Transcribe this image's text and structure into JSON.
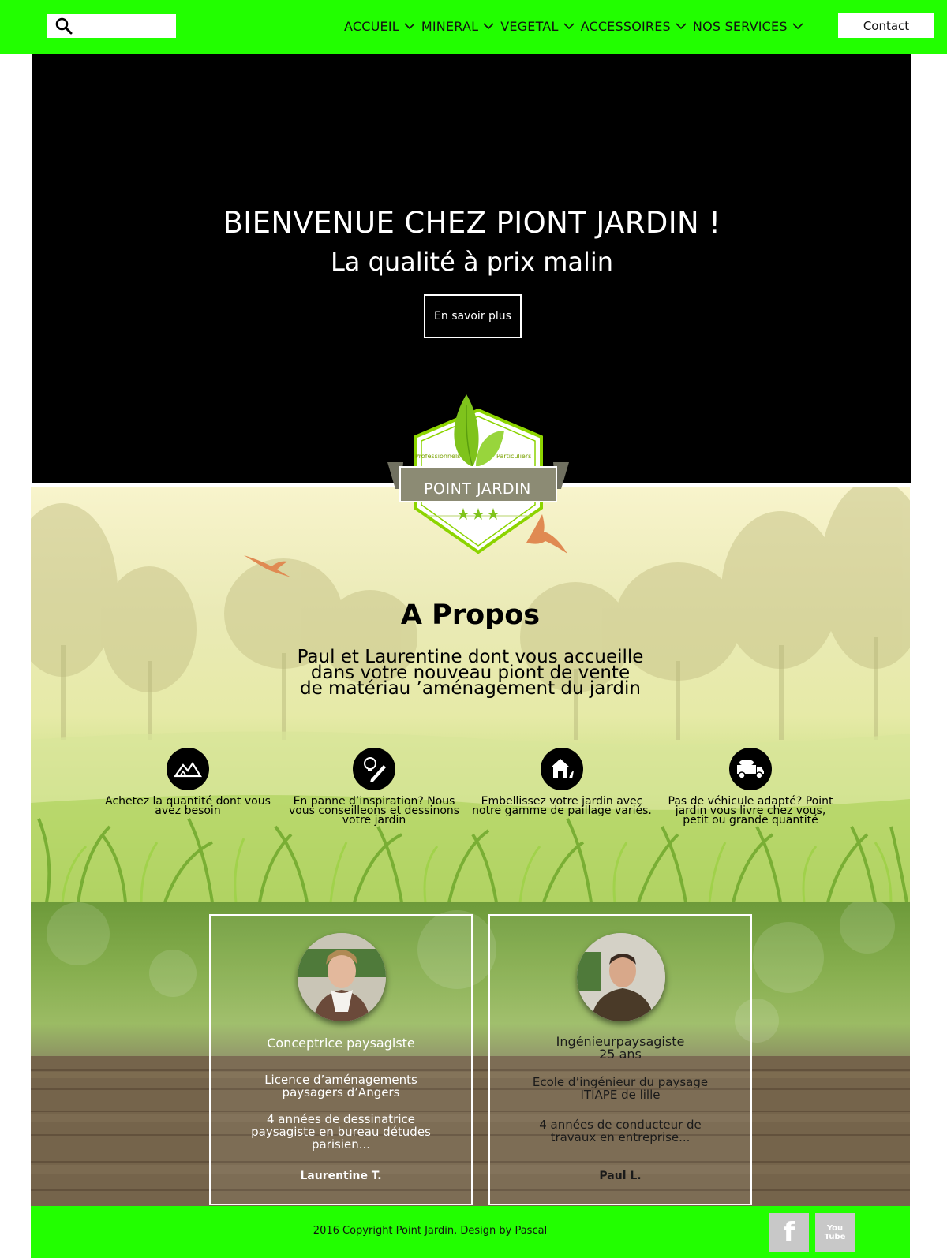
{
  "search": {
    "placeholder": "",
    "value": ""
  },
  "nav": {
    "items": [
      {
        "label": "ACCUEIL"
      },
      {
        "label": "MINERAL"
      },
      {
        "label": "VEGETAL"
      },
      {
        "label": "ACCESSOIRES"
      },
      {
        "label": "NOS SERVICES"
      }
    ],
    "contact_label": "Contact"
  },
  "colors": {
    "accent": "#22ff00",
    "hero_bg": "#000000",
    "logo_green": "#7aa200",
    "logo_gray": "#8c8b74"
  },
  "icons": {
    "search": "search-icon",
    "nav_dropdown": "chevron-down-icon",
    "features": [
      "mountains-icon",
      "lightbulb-pencil-icon",
      "house-garden-icon",
      "dump-truck-icon"
    ],
    "social": [
      "facebook-icon",
      "youtube-icon"
    ]
  },
  "hero": {
    "title": "BIENVENUE CHEZ PIONT JARDIN !",
    "subtitle": "La qualité à prix malin",
    "button_label": "En savoir plus"
  },
  "logo": {
    "left_tag": "Professionnels",
    "right_tag": "Particuliers",
    "name": "POINT  JARDIN"
  },
  "about": {
    "title": "A Propos",
    "text": "Paul et Laurentine dont vous accueille\ndans votre nouveau piont de vente\nde matériau ’aménagement du jardin",
    "features": [
      {
        "text": "Achetez la quantité dont vous\navez besoin"
      },
      {
        "text": "En panne d’inspiration? Nous\nvous conseilleons et dessinons\nvotre jardin"
      },
      {
        "text": "Embellissez votre jardin avec\nnotre gamme de paillage variés."
      },
      {
        "text": "Pas de véhicule adapté? Point\njardin vous livre chez vous,\npetit ou grande quantité"
      }
    ]
  },
  "team": [
    {
      "role": "Conceptrice paysagiste",
      "desc1": "Licence d’aménagements\npaysagers d’Angers",
      "desc2": "4 années de dessinatrice\npaysagiste en bureau détudes\nparisien...",
      "name": "Laurentine T."
    },
    {
      "role": "Ingénieurpaysagiste\n25 ans",
      "desc1": "Ecole d’ingénieur du paysage\nITIAPE de lille",
      "desc2": "4 années de conducteur de\ntravaux en entreprise...",
      "name": "Paul L."
    }
  ],
  "footer": {
    "copyright": "2016 Copyright Point Jardin. Design by Pascal",
    "facebook": "f",
    "youtube": "You Tube"
  }
}
